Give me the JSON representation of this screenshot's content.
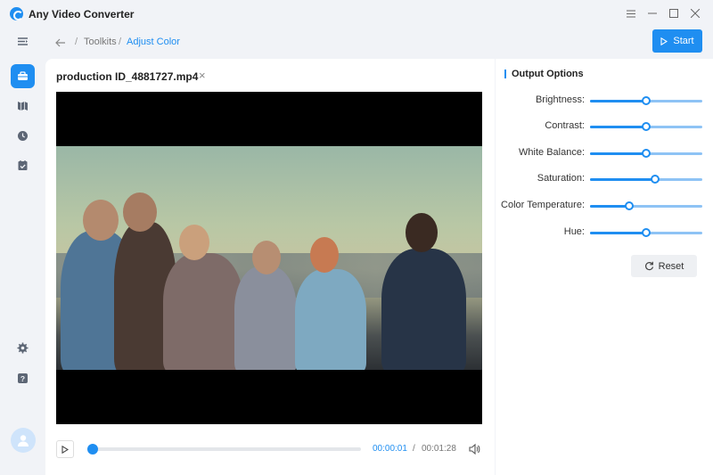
{
  "app": {
    "title": "Any Video Converter"
  },
  "window": {
    "menu_icon": "menu-icon",
    "minimize_icon": "minimize-icon",
    "maximize_icon": "maximize-icon",
    "close_icon": "close-icon"
  },
  "sidebar": {
    "items": [
      {
        "icon": "collapse-menu-icon"
      },
      {
        "icon": "toolbox-icon",
        "active": true
      },
      {
        "icon": "map-icon"
      },
      {
        "icon": "clock-icon"
      },
      {
        "icon": "task-check-icon"
      },
      {
        "icon": "settings-icon"
      },
      {
        "icon": "help-icon"
      }
    ],
    "avatar_icon": "user-avatar-icon"
  },
  "breadcrumb": {
    "sep1": "/",
    "toolkits": "Toolkits",
    "sep2": "/",
    "current": "Adjust Color"
  },
  "toolbar": {
    "start_label": "Start"
  },
  "file": {
    "name": "production ID_4881727.mp4",
    "close": "×"
  },
  "player": {
    "current_time": "00:00:01",
    "separator": "/",
    "total_time": "00:01:28",
    "progress": 0.01
  },
  "options": {
    "title": "Output Options",
    "rows": [
      {
        "label": "Brightness:",
        "value": 0.5
      },
      {
        "label": "Contrast:",
        "value": 0.5
      },
      {
        "label": "White Balance:",
        "value": 0.5
      },
      {
        "label": "Saturation:",
        "value": 0.58
      },
      {
        "label": "Color Temperature:",
        "value": 0.35
      },
      {
        "label": "Hue:",
        "value": 0.5
      }
    ],
    "reset_label": "Reset"
  },
  "colors": {
    "accent": "#1f8ef1"
  }
}
